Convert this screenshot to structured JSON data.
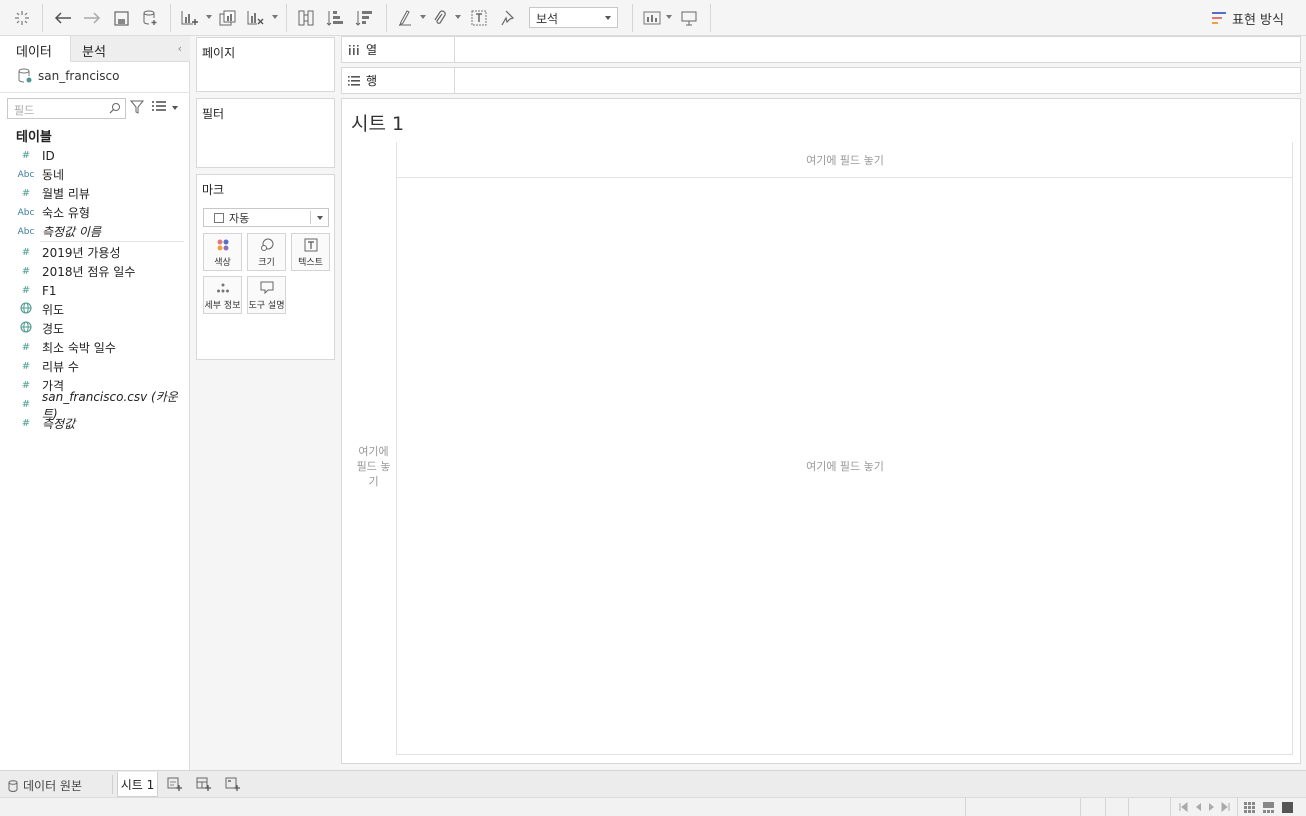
{
  "toolbar": {
    "analysis_select": "보석",
    "show_me_label": "표현 방식",
    "icons": [
      "tableau-logo-icon",
      "undo-icon",
      "redo-icon",
      "save-icon",
      "add-datasource-icon",
      "new-worksheet-icon",
      "duplicate-sheet-icon",
      "clear-sheet-icon",
      "swap-icon",
      "sort-ascending-icon",
      "sort-descending-icon",
      "highlight-icon",
      "group-icon",
      "labels-icon",
      "pin-icon",
      "show-cards-icon",
      "presentation-icon"
    ]
  },
  "data_pane": {
    "tabs": [
      {
        "label": "데이터"
      },
      {
        "label": "분석"
      }
    ],
    "datasource": "san_francisco",
    "search_placeholder": "필드",
    "tables_title": "테이블",
    "fields": [
      {
        "type": "#",
        "name": "ID",
        "italic": false
      },
      {
        "type": "Abc",
        "name": "동네",
        "italic": false
      },
      {
        "type": "#",
        "name": "월별 리뷰",
        "italic": false
      },
      {
        "type": "Abc",
        "name": "숙소 유형",
        "italic": false
      },
      {
        "type": "Abc",
        "name": "측정값 이름",
        "italic": true
      },
      {
        "type": "#",
        "name": "2019년 가용성",
        "italic": false
      },
      {
        "type": "#",
        "name": "2018년 점유 일수",
        "italic": false
      },
      {
        "type": "#",
        "name": "F1",
        "italic": false
      },
      {
        "type": "globe",
        "name": "위도",
        "italic": false
      },
      {
        "type": "globe",
        "name": "경도",
        "italic": false
      },
      {
        "type": "#",
        "name": "최소 숙박 일수",
        "italic": false
      },
      {
        "type": "#",
        "name": "리뷰 수",
        "italic": false
      },
      {
        "type": "#",
        "name": "가격",
        "italic": false
      },
      {
        "type": "#",
        "name": "san_francisco.csv (카운트)",
        "italic": true
      },
      {
        "type": "#",
        "name": "측정값",
        "italic": true
      }
    ]
  },
  "shelves": {
    "pages_title": "페이지",
    "filters_title": "필터",
    "marks_title": "마크",
    "mark_type": "자동",
    "mark_buttons": [
      {
        "label": "색상",
        "icon": "color-icon"
      },
      {
        "label": "크기",
        "icon": "size-icon"
      },
      {
        "label": "텍스트",
        "icon": "text-icon"
      },
      {
        "label": "세부 정보",
        "icon": "detail-icon"
      },
      {
        "label": "도구 설명",
        "icon": "tooltip-icon"
      }
    ],
    "columns_label": "열",
    "rows_label": "행"
  },
  "canvas": {
    "sheet_title": "시트 1",
    "drop_field_col": "여기에 필드 놓기",
    "drop_field_main": "여기에 필드 놓기",
    "drop_field_row": "여기에 필드 놓기"
  },
  "bottom_tabs": {
    "data_source": "데이터 원본",
    "sheet": "시트 1"
  }
}
